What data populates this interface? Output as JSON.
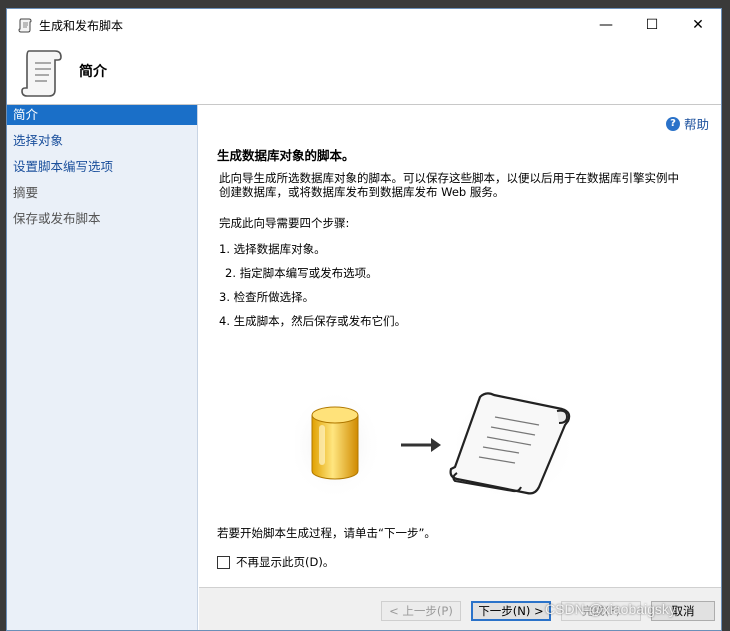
{
  "window": {
    "title": "生成和发布脚本",
    "minimize_glyph": "—",
    "maximize_glyph": "☐",
    "close_glyph": "✕"
  },
  "header": {
    "title": "简介"
  },
  "sidebar": {
    "items": [
      {
        "label": "简介",
        "state": "active"
      },
      {
        "label": "选择对象",
        "state": "link"
      },
      {
        "label": "设置脚本编写选项",
        "state": "link"
      },
      {
        "label": "摘要",
        "state": "disabled"
      },
      {
        "label": "保存或发布脚本",
        "state": "disabled"
      }
    ]
  },
  "content": {
    "help_label": "帮助",
    "help_glyph": "?",
    "title": "生成数据库对象的脚本。",
    "description_line1": "此向导生成所选数据库对象的脚本。可以保存这些脚本，以便以后用于在数据库引擎实例中",
    "description_line2": "创建数据库，或将数据库发布到数据库发布 Web 服务。",
    "steps_intro": "完成此向导需要四个步骤:",
    "steps": [
      "1. 选择数据库对象。",
      "2. 指定脚本编写或发布选项。",
      "3. 检查所做选择。",
      "4. 生成脚本，然后保存或发布它们。"
    ],
    "start_instruction": "若要开始脚本生成过程，请单击“下一步”。",
    "checkbox_label": "不再显示此页(D)。",
    "checkbox_checked": false
  },
  "footer": {
    "prev_label": "< 上一步(P)",
    "next_label": "下一步(N) >",
    "finish_label": "完成(F)",
    "cancel_label": "取消"
  },
  "watermark": "CSDN @xiaobaigsky",
  "colors": {
    "accent": "#1a6fc8",
    "link": "#1a4f9c",
    "sidebar_bg": "#eaf0f8"
  }
}
